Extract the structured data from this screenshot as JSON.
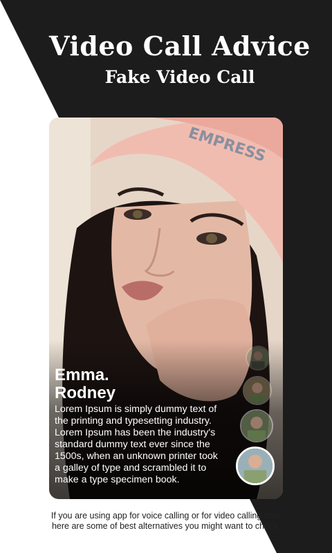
{
  "header": {
    "title": "Video Call Advice",
    "subtitle": "Fake Video Call"
  },
  "profile": {
    "name_line1": "Emma.",
    "name_line2": "Rodney",
    "description": "Lorem Ipsum is simply dummy text of the printing and typesetting industry. Lorem Ipsum has been the industry's standard dummy text ever since the 1500s, when an unknown printer took a galley of type and scrambled it to make a type specimen book.",
    "cap_text": "EMPRESS"
  },
  "footer": {
    "text": "If you are using app for voice calling or for video calling then here are some of best alternatives you might want to check."
  },
  "colors": {
    "background_dark": "#1c1c1c",
    "background_light": "#ffffff",
    "text_light": "#ffffff"
  }
}
